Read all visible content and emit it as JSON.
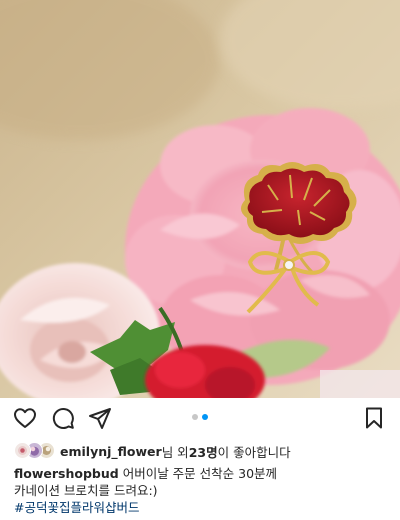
{
  "post": {
    "image_icon": "carnation-brooch-photo",
    "actions": {
      "like_icon": "heart-icon",
      "comment_icon": "comment-icon",
      "share_icon": "paper-plane-icon",
      "save_icon": "bookmark-icon"
    },
    "carousel": {
      "total": 2,
      "active": 2
    },
    "likes": {
      "liker": "emilynj_flower",
      "text_before": "님 외 ",
      "count": "23명",
      "text_after": "이 좋아합니다"
    },
    "caption": {
      "username": "flowershopbud",
      "line1": " 어버이날 주문 선착순 30분께",
      "line2": "카네이션 브로치를 드려요:)",
      "hashtag": "#공덕꽃집플라워샵버드"
    }
  },
  "colors": {
    "accent_link": "#0095f6",
    "hashtag": "#00376b",
    "text": "#262626"
  }
}
